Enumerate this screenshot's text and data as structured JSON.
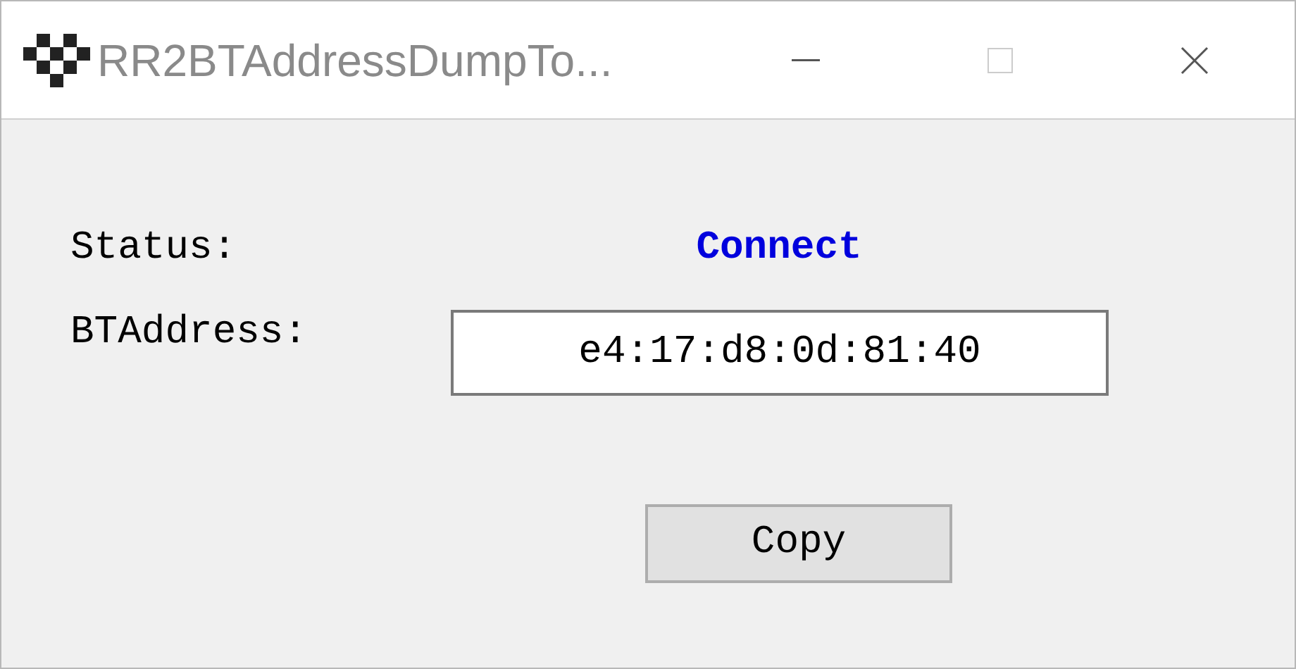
{
  "window": {
    "title": "RR2BTAddressDumpTo..."
  },
  "status": {
    "label": "Status:",
    "value": "Connect"
  },
  "bt_address": {
    "label": "BTAddress:",
    "value": "e4:17:d8:0d:81:40"
  },
  "buttons": [
    {
      "label": "Copy"
    }
  ]
}
